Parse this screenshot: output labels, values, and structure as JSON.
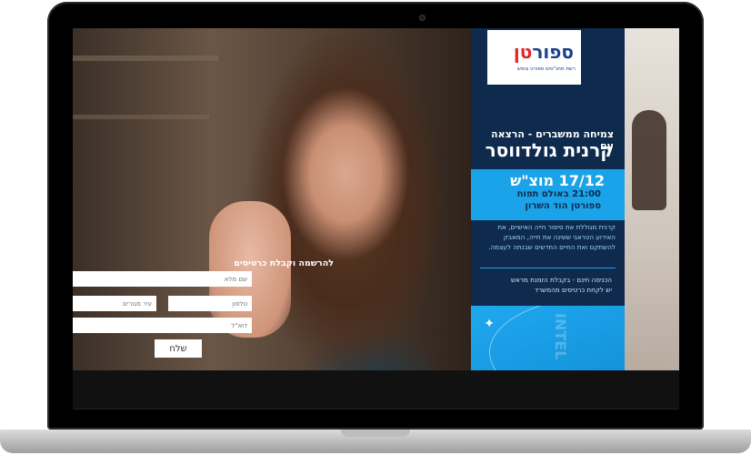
{
  "logo": {
    "brand_main": "ספור",
    "brand_red": "טן",
    "tagline": "רשת מתנ\"סים ספורט ונופש"
  },
  "event": {
    "headline": "צמיחה ממשברים - הרצאה עם",
    "speaker": "קרנית גולדווסר",
    "date": "17/12 מוצ\"ש",
    "time": "21:00 באולם תפוח",
    "venue": "ספורטן הוד השרון",
    "description": "קרנית מגוללת את סיפור חייה האישיים, את האירוע הטראגי ששינה את חייה, המאבק להשתקם ואת החיים החדשים שבנתה לעצמה.",
    "entry_line1": "הכניסה חינם - בקבלת הזמנת מראש",
    "entry_line2": "יש לקחת כרטיסים מהמשרד",
    "sign_text": "INTEL"
  },
  "form": {
    "title": "להרשמה וקבלת כרטיסים",
    "name_placeholder": "שם מלא",
    "phone_placeholder": "טלפון",
    "city_placeholder": "עיר מגורים",
    "email_placeholder": "דוא\"ל",
    "submit_label": "שלח"
  },
  "colors": {
    "panel_bg": "#0e2a4d",
    "accent_blue": "#1aa3e8",
    "logo_blue": "#1c3f8c",
    "logo_red": "#e0262b"
  }
}
